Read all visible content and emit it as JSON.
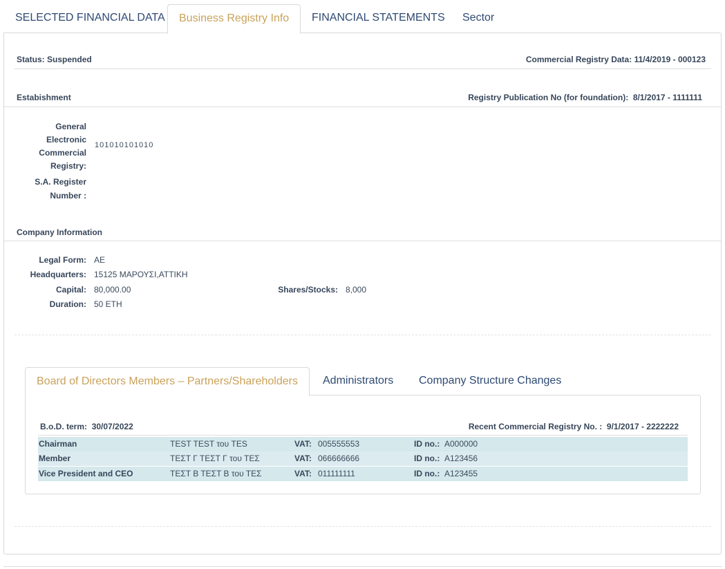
{
  "tabs": [
    {
      "label": "SELECTED FINANCIAL DATA",
      "active": false
    },
    {
      "label": "Business Registry Info",
      "active": true
    },
    {
      "label": "FINANCIAL STATEMENTS",
      "active": false
    },
    {
      "label": "Sector",
      "active": false
    }
  ],
  "status": {
    "label": "Status:",
    "value": "Suspended",
    "registry_label": "Commercial Registry Data:",
    "registry_value": "11/4/2019 - 000123"
  },
  "establishment": {
    "title": "Estabishment",
    "publication_label": "Registry Publication No (for foundation):",
    "publication_value": "8/1/2017 - 1111111",
    "gemi_label_lines": [
      "General",
      "Electronic",
      "Commercial",
      "Registry:"
    ],
    "gemi_value": "101010101010",
    "sa_label_lines": [
      "S.A. Register",
      "Number :"
    ]
  },
  "company": {
    "title": "Company Information",
    "legal_form_label": "Legal Form:",
    "legal_form_value": "AE",
    "hq_label": "Headquarters:",
    "hq_value": "15125 ΜΑΡΟΥΣΙ,ΑΤΤΙΚΗ",
    "capital_label": "Capital:",
    "capital_value": "80,000.00",
    "shares_label": "Shares/Stocks:",
    "shares_value": "8,000",
    "duration_label": "Duration:",
    "duration_value": "50 ΕΤΗ"
  },
  "inner_tabs": [
    {
      "label": "Board of Directors Members – Partners/Shareholders",
      "active": true
    },
    {
      "label": "Administrators",
      "active": false
    },
    {
      "label": "Company Structure Changes",
      "active": false
    }
  ],
  "bod": {
    "term_label": "B.o.D. term:",
    "term_value": "30/07/2022",
    "recent_label": "Recent Commercial Registry No. :",
    "recent_value": "9/1/2017 - 2222222",
    "vat_label": "VAT:",
    "id_label": "ID no.:",
    "members": [
      {
        "role": "Chairman",
        "name": "TEST TEST του TES",
        "vat": "005555553",
        "id": "A000000"
      },
      {
        "role": "Member",
        "name": "ΤΕΣΤ Γ ΤΕΣΤ Γ του ΤΕΣ",
        "vat": "066666666",
        "id": "A123456"
      },
      {
        "role": "Vice President and CEO",
        "name": "ΤΕΣΤ Β ΤΕΣΤ Β του ΤΕΣ",
        "vat": "011111111",
        "id": "A123455"
      }
    ]
  }
}
